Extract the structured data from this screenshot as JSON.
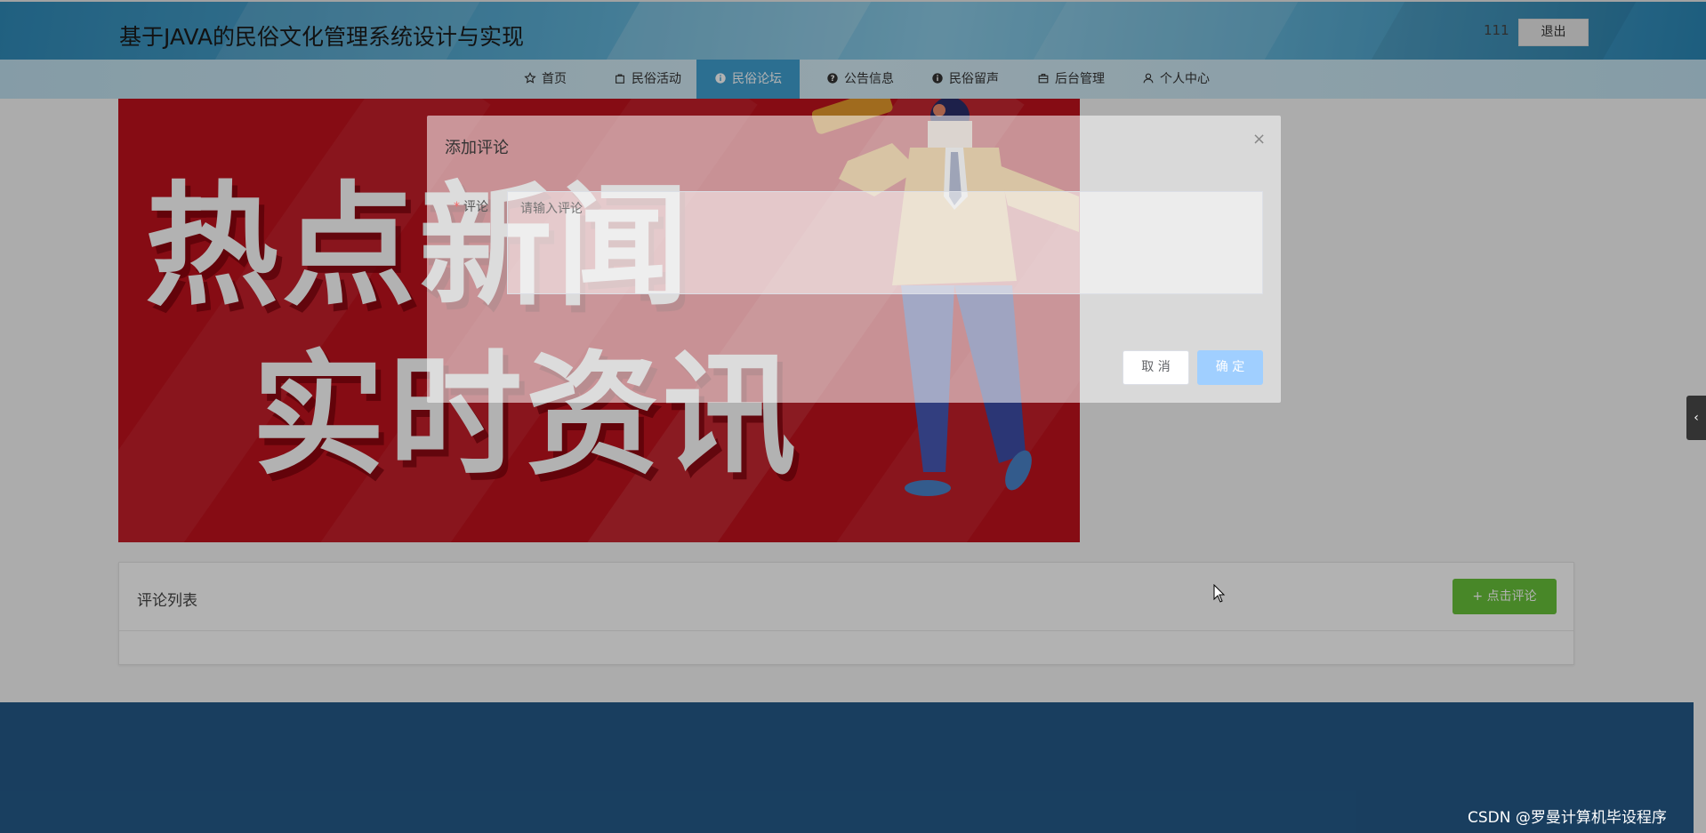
{
  "header": {
    "site_title": "基于JAVA的民俗文化管理系统设计与实现",
    "username": "111",
    "logout_label": "退出"
  },
  "nav": {
    "items": [
      {
        "label": "首页",
        "icon": "star-icon"
      },
      {
        "label": "民俗活动",
        "icon": "bag-icon"
      },
      {
        "label": "民俗论坛",
        "icon": "info-circle-icon",
        "active": true
      },
      {
        "label": "公告信息",
        "icon": "question-circle-icon"
      },
      {
        "label": "民俗留声",
        "icon": "info-circle-icon"
      },
      {
        "label": "后台管理",
        "icon": "briefcase-icon"
      },
      {
        "label": "个人中心",
        "icon": "user-icon"
      }
    ],
    "active_color": "#3f9fd0"
  },
  "banner": {
    "line1": "热点新闻",
    "line2": "实时资讯"
  },
  "comments_card": {
    "title": "评论列表",
    "add_button_label": "点击评论"
  },
  "dialog": {
    "title": "添加评论",
    "close_symbol": "×",
    "field_label": "评论",
    "textarea_placeholder": "请输入评论",
    "cancel_label": "取 消",
    "confirm_label": "确 定"
  },
  "side_tab": {
    "symbol": "‹"
  },
  "watermark": "CSDN @罗曼计算机毕设程序",
  "colors": {
    "header_accent": "#2f8ab8",
    "success": "#67c23a",
    "primary_disabled": "#a0cfff",
    "footer": "#245a89",
    "banner_red": "#c1121d"
  }
}
